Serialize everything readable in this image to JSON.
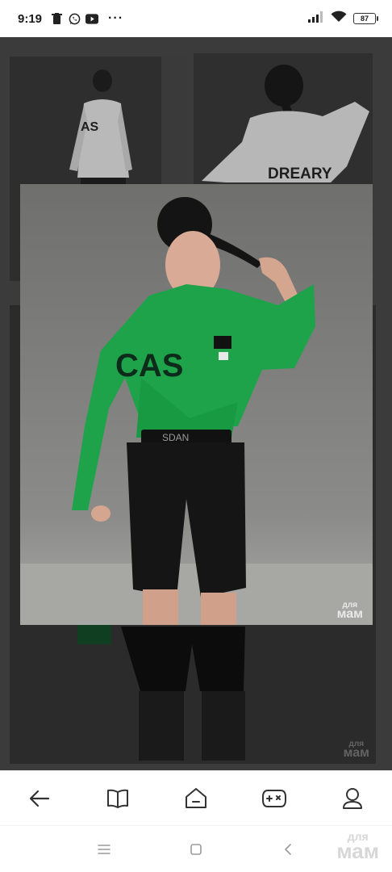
{
  "status_bar": {
    "time": "9:19",
    "left_icons": [
      "trash-icon",
      "whatsapp-icon",
      "youtube-icon"
    ],
    "more": "···",
    "battery": "87"
  },
  "gallery": {
    "thumb_top_right_text": "DREARY",
    "thumb_top_left_text": "AS",
    "main_shirt_text": "CAS",
    "main_waistband_text": "SDAN",
    "watermark_small": "для",
    "watermark_big": "мам"
  },
  "bottom_nav": {
    "items": [
      "back-arrow-icon",
      "book-icon",
      "home-icon",
      "gamepad-icon",
      "profile-icon"
    ]
  },
  "system_nav": {
    "items": [
      "menu-icon",
      "square-icon",
      "chevron-left-icon"
    ],
    "watermark_small": "для",
    "watermark_big": "мам"
  },
  "colors": {
    "viewer_bg": "#3b3b3b",
    "shirt_green": "#1ea34a",
    "shorts_black": "#151515"
  }
}
